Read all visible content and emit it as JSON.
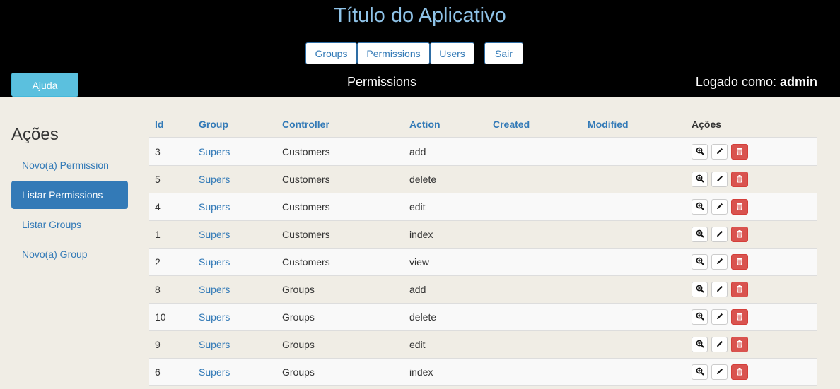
{
  "header": {
    "app_title": "Título do Aplicativo",
    "nav": [
      "Groups",
      "Permissions",
      "Users",
      "Sair"
    ],
    "help_label": "Ajuda",
    "page_heading": "Permissions",
    "logged_prefix": "Logado como:",
    "logged_user": "admin"
  },
  "sidebar": {
    "title": "Ações",
    "items": [
      "Novo(a) Permission",
      "Listar Permissions",
      "Listar Groups",
      "Novo(a) Group"
    ],
    "active_index": 1
  },
  "table": {
    "columns": [
      "Id",
      "Group",
      "Controller",
      "Action",
      "Created",
      "Modified",
      "Ações"
    ],
    "rows": [
      {
        "id": "3",
        "group": "Supers",
        "controller": "Customers",
        "action": "add",
        "created": "",
        "modified": ""
      },
      {
        "id": "5",
        "group": "Supers",
        "controller": "Customers",
        "action": "delete",
        "created": "",
        "modified": ""
      },
      {
        "id": "4",
        "group": "Supers",
        "controller": "Customers",
        "action": "edit",
        "created": "",
        "modified": ""
      },
      {
        "id": "1",
        "group": "Supers",
        "controller": "Customers",
        "action": "index",
        "created": "",
        "modified": ""
      },
      {
        "id": "2",
        "group": "Supers",
        "controller": "Customers",
        "action": "view",
        "created": "",
        "modified": ""
      },
      {
        "id": "8",
        "group": "Supers",
        "controller": "Groups",
        "action": "add",
        "created": "",
        "modified": ""
      },
      {
        "id": "10",
        "group": "Supers",
        "controller": "Groups",
        "action": "delete",
        "created": "",
        "modified": ""
      },
      {
        "id": "9",
        "group": "Supers",
        "controller": "Groups",
        "action": "edit",
        "created": "",
        "modified": ""
      },
      {
        "id": "6",
        "group": "Supers",
        "controller": "Groups",
        "action": "index",
        "created": "",
        "modified": ""
      }
    ],
    "action_icons": [
      "zoom-in-icon",
      "pencil-icon",
      "trash-icon"
    ]
  },
  "colors": {
    "header_bg": "#000000",
    "title": "#8fc3e8",
    "link": "#337ab7",
    "help_button": "#5bc0de",
    "delete_button": "#d9534f",
    "page_bg": "#f0ede5"
  }
}
